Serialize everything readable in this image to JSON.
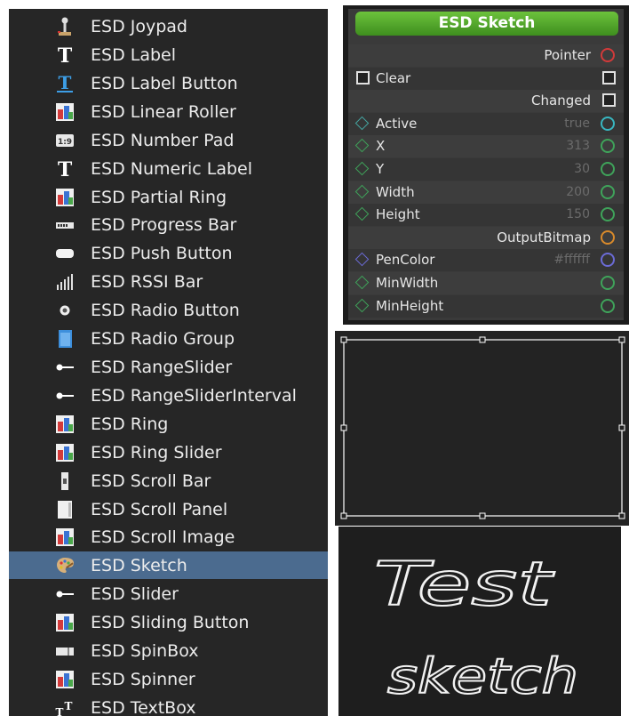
{
  "component_list": {
    "items": [
      {
        "label": "ESD Joypad",
        "icon": "joystick-icon"
      },
      {
        "label": "ESD Label",
        "icon": "text-t-icon"
      },
      {
        "label": "ESD Label Button",
        "icon": "text-t-button-icon"
      },
      {
        "label": "ESD Linear Roller",
        "icon": "widget-icon"
      },
      {
        "label": "ESD Number Pad",
        "icon": "number-pad-icon"
      },
      {
        "label": "ESD Numeric Label",
        "icon": "text-t-icon"
      },
      {
        "label": "ESD Partial Ring",
        "icon": "widget-icon"
      },
      {
        "label": "ESD Progress Bar",
        "icon": "progress-bar-icon"
      },
      {
        "label": "ESD Push Button",
        "icon": "push-button-icon"
      },
      {
        "label": "ESD RSSI Bar",
        "icon": "signal-bars-icon"
      },
      {
        "label": "ESD Radio Button",
        "icon": "radio-dot-icon"
      },
      {
        "label": "ESD Radio Group",
        "icon": "radio-group-icon"
      },
      {
        "label": "ESD RangeSlider",
        "icon": "slider-icon"
      },
      {
        "label": "ESD RangeSliderInterval",
        "icon": "slider-icon"
      },
      {
        "label": "ESD Ring",
        "icon": "widget-icon"
      },
      {
        "label": "ESD Ring Slider",
        "icon": "widget-icon"
      },
      {
        "label": "ESD Scroll Bar",
        "icon": "scroll-bar-icon"
      },
      {
        "label": "ESD Scroll Panel",
        "icon": "scroll-panel-icon"
      },
      {
        "label": "ESD Scroll Image",
        "icon": "widget-icon"
      },
      {
        "label": "ESD Sketch",
        "icon": "palette-icon",
        "selected": true
      },
      {
        "label": "ESD Slider",
        "icon": "slider-icon"
      },
      {
        "label": "ESD Sliding Button",
        "icon": "widget-icon"
      },
      {
        "label": "ESD SpinBox",
        "icon": "spinbox-icon"
      },
      {
        "label": "ESD Spinner",
        "icon": "widget-icon"
      },
      {
        "label": "ESD TextBox",
        "icon": "textbox-icon"
      }
    ]
  },
  "node": {
    "title": "ESD Sketch",
    "rows": [
      {
        "name": "Pointer",
        "side": "right",
        "pin": "pointer-pin-icon",
        "pin_color": "#d23a3a"
      },
      {
        "name": "Clear",
        "side": "left",
        "box_left": true,
        "box_right": true
      },
      {
        "name": "Changed",
        "side": "right",
        "box_right": true
      },
      {
        "name": "Active",
        "side": "left",
        "value": "true",
        "pin_in_color": "#45a6a2",
        "pin_color": "#38b6c0"
      },
      {
        "name": "X",
        "side": "left",
        "value": "313",
        "pin_in_color": "#3fa35a",
        "pin_color": "#3fa35a"
      },
      {
        "name": "Y",
        "side": "left",
        "value": "30",
        "pin_in_color": "#3fa35a",
        "pin_color": "#3fa35a"
      },
      {
        "name": "Width",
        "side": "left",
        "value": "200",
        "pin_in_color": "#3fa35a",
        "pin_color": "#3fa35a"
      },
      {
        "name": "Height",
        "side": "left",
        "value": "150",
        "pin_in_color": "#3fa35a",
        "pin_color": "#3fa35a"
      },
      {
        "name": "OutputBitmap",
        "side": "right",
        "pin_color": "#d98a2b"
      },
      {
        "name": "PenColor",
        "side": "left",
        "value": "#ffffff",
        "pin_in_color": "#6b6bd6",
        "pin_color": "#6b6bd6"
      },
      {
        "name": "MinWidth",
        "side": "left",
        "pin_in_color": "#3fa35a",
        "pin_color": "#3fa35a"
      },
      {
        "name": "MinHeight",
        "side": "left",
        "pin_in_color": "#3fa35a",
        "pin_color": "#3fa35a"
      }
    ]
  },
  "sketch": {
    "line1": "Test",
    "line2": "sketch",
    "stroke_color": "#ffffff"
  }
}
